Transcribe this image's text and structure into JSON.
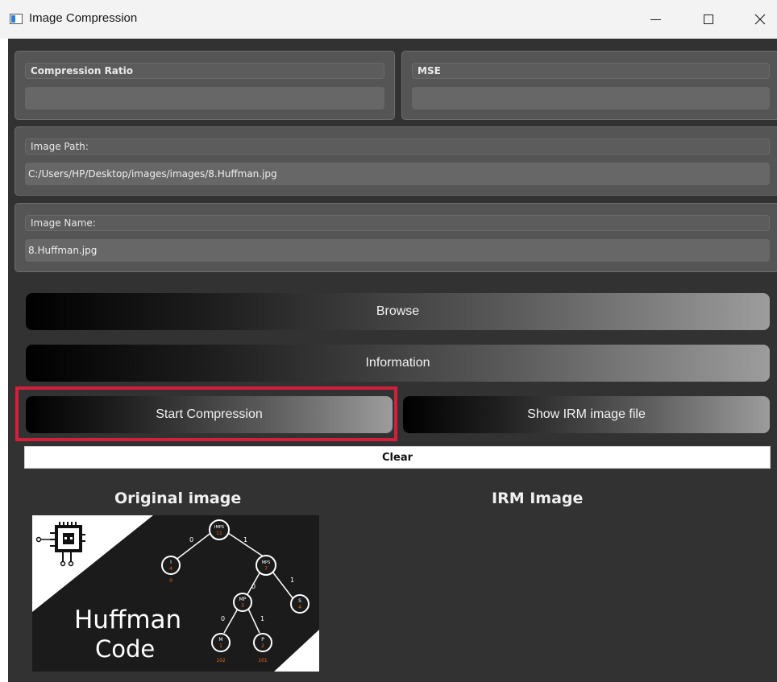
{
  "window": {
    "title": "Image Compression"
  },
  "stats": {
    "compression_ratio_label": "Compression Ratio",
    "compression_ratio_value": "",
    "mse_label": "MSE",
    "mse_value": ""
  },
  "image_path": {
    "label": "Image Path:",
    "value": "C:/Users/HP/Desktop/images/images/8.Huffman.jpg"
  },
  "image_name": {
    "label": "Image Name:",
    "value": "8.Huffman.jpg"
  },
  "buttons": {
    "browse": "Browse",
    "information": "Information",
    "start_compression": "Start Compression",
    "show_irm": "Show IRM  image file",
    "clear": "Clear"
  },
  "sections": {
    "original": "Original image",
    "irm": "IRM Image"
  },
  "original_image": {
    "title_line1": "Huffman",
    "title_line2": "Code",
    "nodes": [
      {
        "top": "IMPS",
        "bottom": "11"
      },
      {
        "top": "I",
        "bottom": "4"
      },
      {
        "top": "MPS",
        "bottom": "7"
      },
      {
        "top": "MP",
        "bottom": "3"
      },
      {
        "top": "S",
        "bottom": "4"
      },
      {
        "top": "M",
        "bottom": "1"
      },
      {
        "top": "P",
        "bottom": "2"
      }
    ],
    "edge_labels": [
      "0",
      "1",
      "0",
      "1",
      "0",
      "1"
    ],
    "codes": [
      "0",
      "102",
      "101"
    ]
  },
  "highlight_color": "#d21f3c"
}
